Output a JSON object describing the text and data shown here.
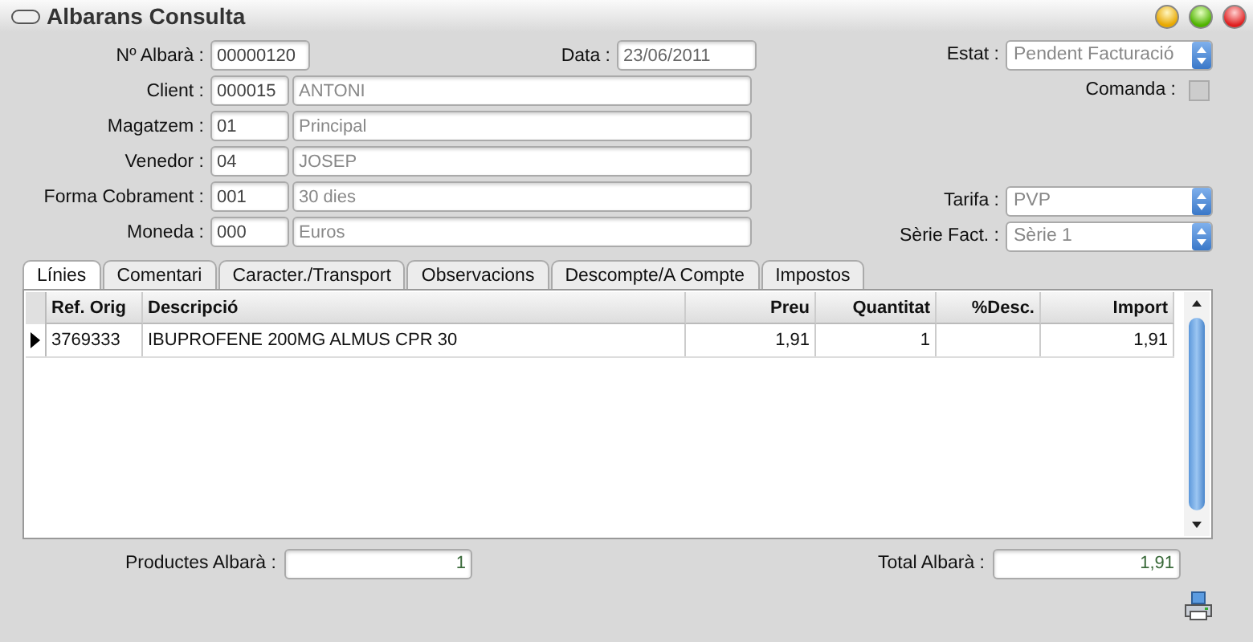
{
  "window": {
    "title": "Albarans Consulta"
  },
  "header_fields": [
    {
      "label": "Nº Albarà :",
      "code": "00000120",
      "side_label": "Data :",
      "side_value": "23/06/2011"
    },
    {
      "label": "Client :",
      "code": "000015",
      "name": "ANTONI"
    },
    {
      "label": "Magatzem :",
      "code": "01",
      "name": "Principal"
    },
    {
      "label": "Venedor :",
      "code": "04",
      "name": "JOSEP"
    },
    {
      "label": "Forma Cobrament :",
      "code": "001",
      "name": "30 dies"
    },
    {
      "label": "Moneda :",
      "code": "000",
      "name": "Euros"
    }
  ],
  "status_fields": [
    {
      "kind": "select",
      "label": "Estat :",
      "value": "Pendent Facturació"
    },
    {
      "kind": "checkbox",
      "label": "Comanda :",
      "checked": false
    }
  ],
  "pricing_fields": [
    {
      "kind": "select",
      "label": "Tarifa :",
      "value": "PVP"
    },
    {
      "kind": "select",
      "label": "Sèrie Fact. :",
      "value": "Sèrie 1"
    }
  ],
  "tabs": [
    {
      "label": "Línies",
      "selected": true
    },
    {
      "label": "Comentari",
      "selected": false
    },
    {
      "label": "Caracter./Transport",
      "selected": false
    },
    {
      "label": "Observacions",
      "selected": false
    },
    {
      "label": "Descompte/A Compte",
      "selected": false
    },
    {
      "label": "Impostos",
      "selected": false
    }
  ],
  "table": {
    "columns": [
      {
        "label": "Ref. Orig"
      },
      {
        "label": "Descripció"
      },
      {
        "label": "Preu"
      },
      {
        "label": "Quantitat"
      },
      {
        "label": "%Desc."
      },
      {
        "label": "Import"
      }
    ],
    "rows": [
      {
        "selected": true,
        "cells": [
          "3769333",
          "IBUPROFENE 200MG ALMUS CPR 30",
          "1,91",
          "1",
          "",
          "1,91"
        ]
      }
    ]
  },
  "footer": [
    {
      "label": "Productes Albarà :",
      "value": "1"
    },
    {
      "label": "Total Albarà :",
      "value": "1,91"
    }
  ]
}
